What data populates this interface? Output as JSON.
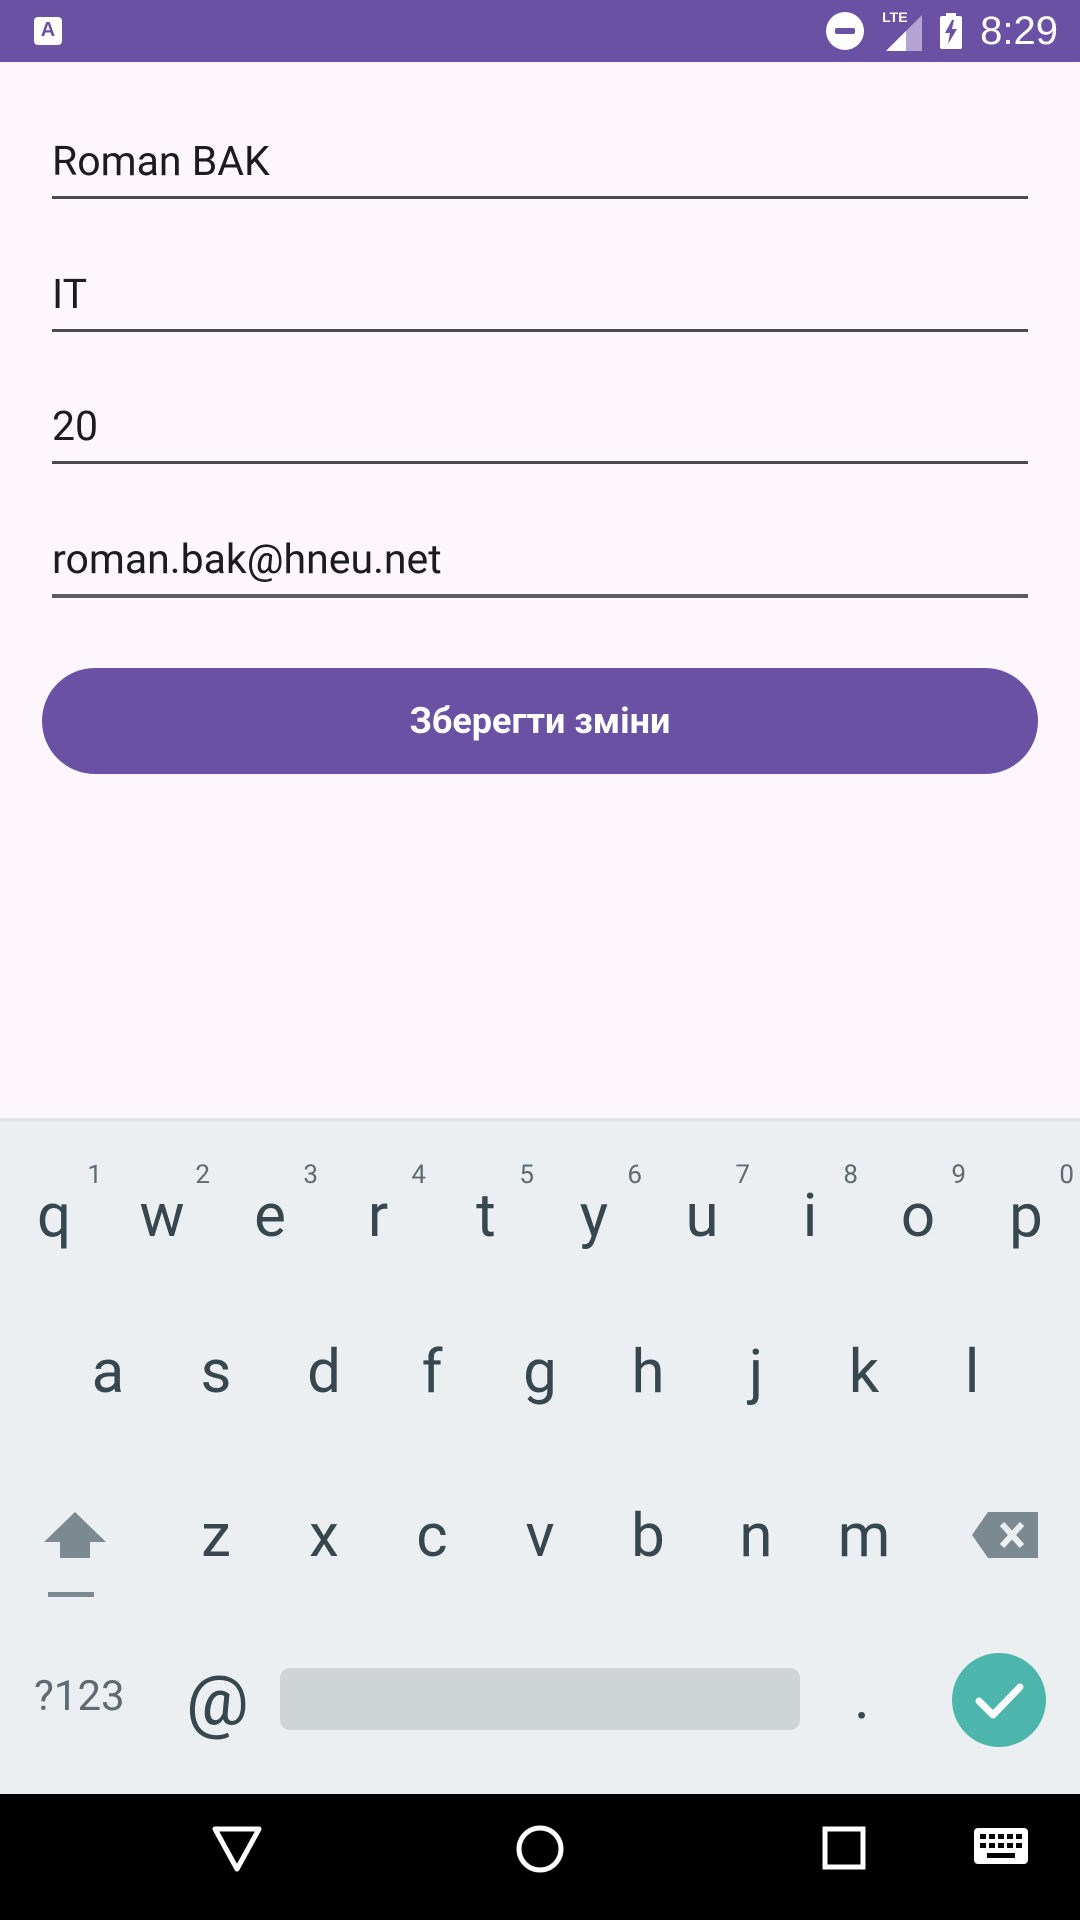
{
  "status_bar": {
    "app_icon_letter": "A",
    "network": "LTE",
    "time": "8:29"
  },
  "form": {
    "name_value": "Roman BAK",
    "department_value": "IT",
    "age_value": "20",
    "email_value": "roman.bak@hneu.net",
    "save_label": "Зберегти зміни"
  },
  "keyboard": {
    "row1": [
      {
        "letter": "q",
        "hint": "1"
      },
      {
        "letter": "w",
        "hint": "2"
      },
      {
        "letter": "e",
        "hint": "3"
      },
      {
        "letter": "r",
        "hint": "4"
      },
      {
        "letter": "t",
        "hint": "5"
      },
      {
        "letter": "y",
        "hint": "6"
      },
      {
        "letter": "u",
        "hint": "7"
      },
      {
        "letter": "i",
        "hint": "8"
      },
      {
        "letter": "o",
        "hint": "9"
      },
      {
        "letter": "p",
        "hint": "0"
      }
    ],
    "row2": [
      "a",
      "s",
      "d",
      "f",
      "g",
      "h",
      "j",
      "k",
      "l"
    ],
    "row3": [
      "z",
      "x",
      "c",
      "v",
      "b",
      "n",
      "m"
    ],
    "symbols_label": "?123",
    "at_label": "@",
    "period_label": "."
  },
  "icons": {
    "status": [
      "app-launcher-icon",
      "do-not-disturb-icon",
      "lte-signal-icon",
      "battery-charging-icon"
    ],
    "keyboard": [
      "shift-icon",
      "backspace-icon",
      "enter-check-icon"
    ],
    "navigation": [
      "back-icon",
      "home-icon",
      "recents-icon",
      "keyboard-switch-icon"
    ]
  },
  "colors": {
    "primary": "#6a51a3",
    "background": "#fdf7fd",
    "keyboard_bg": "#eceff1",
    "enter_key": "#4db6ac"
  }
}
